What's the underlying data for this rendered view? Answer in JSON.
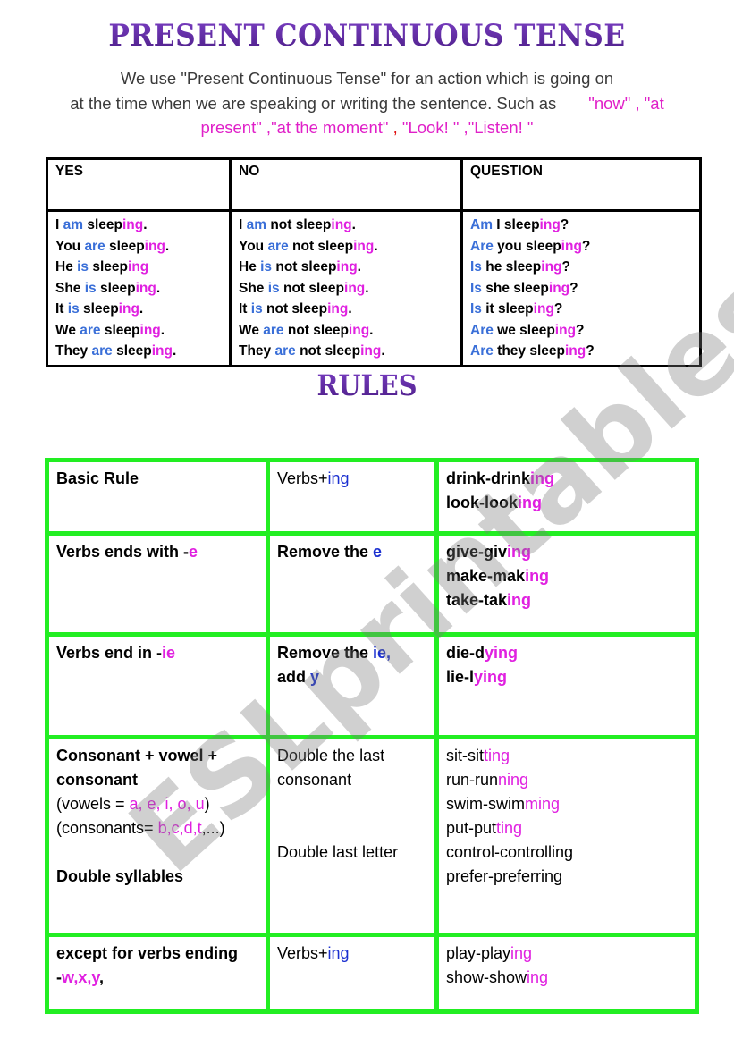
{
  "title": "PRESENT CONTINUOUS TENSE",
  "intro": {
    "line1": "We use \"Present Continuous Tense\" for an action which is going on",
    "line2_plain": "at the time when we are speaking or writing the sentence. Such as",
    "ex_now": "\"now\" , \"at",
    "ex_present": "present\" ,\"at the moment\"",
    "comma": " , ",
    "ex_look": "\"Look! \" ,\"Listen! \""
  },
  "conjugation": {
    "headers": [
      "YES",
      "NO",
      "QUESTION"
    ],
    "yes": [
      {
        "a": "I ",
        "b": "am",
        "c": " sleep",
        "d": "ing",
        "e": "."
      },
      {
        "a": "You ",
        "b": "are",
        "c": " sleep",
        "d": "ing",
        "e": "."
      },
      {
        "a": "He ",
        "b": "is",
        "c": " sleep",
        "d": "ing",
        "e": ""
      },
      {
        "a": "She ",
        "b": "is",
        "c": " sleep",
        "d": "ing",
        "e": "."
      },
      {
        "a": "It ",
        "b": "is",
        "c": " sleep",
        "d": "ing",
        "e": "."
      },
      {
        "a": "We ",
        "b": "are",
        "c": " sleep",
        "d": "ing",
        "e": "."
      },
      {
        "a": "They ",
        "b": "are",
        "c": " sleep",
        "d": "ing",
        "e": "."
      }
    ],
    "no": [
      {
        "a": "I ",
        "b": "am",
        "c": " not sleep",
        "d": "ing",
        "e": "."
      },
      {
        "a": "You ",
        "b": "are",
        "c": " not sleep",
        "d": "ing",
        "e": "."
      },
      {
        "a": "He ",
        "b": "is",
        "c": " not sleep",
        "d": "ing",
        "e": "."
      },
      {
        "a": "She ",
        "b": "is",
        "c": " not sleep",
        "d": "ing",
        "e": "."
      },
      {
        "a": "It ",
        "b": "is",
        "c": " not sleep",
        "d": "ing",
        "e": "."
      },
      {
        "a": "We ",
        "b": "are",
        "c": " not sleep",
        "d": "ing",
        "e": "."
      },
      {
        "a": "They ",
        "b": "are",
        "c": " not sleep",
        "d": "ing",
        "e": "."
      }
    ],
    "question": [
      {
        "b": "Am",
        "c": " I sleep",
        "d": "ing",
        "e": "?"
      },
      {
        "b": "Are",
        "c": " you sleep",
        "d": "ing",
        "e": "?"
      },
      {
        "b": "Is",
        "c": " he sleep",
        "d": "ing",
        "e": "?"
      },
      {
        "b": "Is",
        "c": " she sleep",
        "d": "ing",
        "e": "?"
      },
      {
        "b": "Is",
        "c": " it sleep",
        "d": "ing",
        "e": "?"
      },
      {
        "b": "Are",
        "c": " we sleep",
        "d": "ing",
        "e": "?"
      },
      {
        "b": "Are",
        "c": " they sleep",
        "d": "ing",
        "e": "?"
      }
    ]
  },
  "rules_title": "RULES",
  "rules": {
    "r1": {
      "rule": "Basic Rule",
      "how_a": "Verbs+",
      "how_b": "ing",
      "ex": [
        [
          "drink-drink",
          "ing"
        ],
        [
          "look-look",
          "ing"
        ]
      ]
    },
    "r2": {
      "rule_a": "Verbs ends with -",
      "rule_b": "e",
      "how_a": "Remove the ",
      "how_b": "e",
      "ex": [
        [
          "give-giv",
          "ing"
        ],
        [
          "make-mak",
          "ing"
        ],
        [
          "take-tak",
          "ing"
        ]
      ]
    },
    "r3": {
      "rule_a": "Verbs end in -",
      "rule_b": "ie",
      "how_a": "Remove the ",
      "how_b": "ie,",
      "how_c": "add ",
      "how_d": "y",
      "ex": [
        [
          "die-d",
          "ying"
        ],
        [
          "lie-l",
          "ying"
        ]
      ]
    },
    "r4": {
      "rule_a": "Consonant + vowel  +",
      "rule_b": "consonant",
      "vowels_a": "(vowels = ",
      "vowels_b": "a, e, i, o, u",
      "vowels_c": ")",
      "cons_a": "(consonants= ",
      "cons_b": "b,c,d,t",
      "cons_c": ",...)",
      "rule_c": "Double syllables",
      "how_a": "Double the last",
      "how_b": "consonant",
      "how_c": "Double last letter",
      "ex": [
        [
          "sit-sit",
          "ting"
        ],
        [
          "run-run",
          "ning"
        ],
        [
          "swim-swim",
          "ming"
        ],
        [
          "put-put",
          "ting"
        ],
        [
          "control-controlling",
          ""
        ],
        [
          "prefer-preferring",
          ""
        ]
      ]
    },
    "r5": {
      "rule_a": "except for verbs ending",
      "rule_b": "-",
      "rule_c": "w,x,y",
      "rule_d": ",",
      "how_a": "Verbs+",
      "how_b": "ing",
      "ex": [
        [
          "play-play",
          "ing"
        ],
        [
          "show-show",
          "ing"
        ]
      ]
    }
  },
  "watermark": "ESLprintables.com"
}
